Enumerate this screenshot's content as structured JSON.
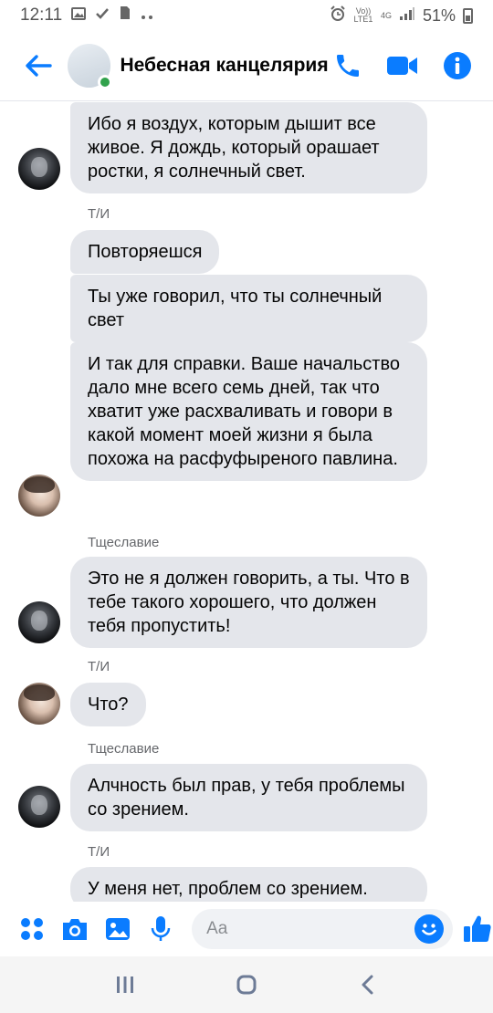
{
  "status_bar": {
    "time": "12:11",
    "left_icons": [
      "image-icon",
      "check-icon",
      "sim-icon",
      "more-icon"
    ],
    "volte": "Vo)) LTE1",
    "network": "4G",
    "battery": "51%"
  },
  "header": {
    "title": "Небесная канцелярия",
    "online": true
  },
  "chat": {
    "messages": [
      {
        "sender": "",
        "avatar": "dark",
        "text": "Ибо я воздух, которым дышит все живое. Я дождь, который орашает ростки, я солнечный свет."
      },
      {
        "sender": "Т/И",
        "avatar": "girl",
        "text": "Повторяешся"
      },
      {
        "sender": "",
        "avatar": "girl",
        "text": "Ты уже говорил, что ты солнечный свет"
      },
      {
        "sender": "",
        "avatar": "girl",
        "text": "И так для справки. Ваше начальство дало мне всего семь дней, так что хватит уже расхваливать и говори в какой момент моей жизни я  была похожа на расфуфыреного павлина."
      },
      {
        "sender": "Тщеславие",
        "avatar": "dark",
        "text": "Это не я должен говорить, а ты. Что в тебе такого хорошего, что должен тебя пропустить!"
      },
      {
        "sender": "Т/И",
        "avatar": "girl",
        "text": "Что?"
      },
      {
        "sender": "Тщеславие",
        "avatar": "dark",
        "text": "Алчность был прав, у тебя проблемы со зрением."
      },
      {
        "sender": "Т/И",
        "avatar": "girl",
        "text": "У меня нет, проблем со зрением."
      }
    ]
  },
  "composer": {
    "placeholder": "Aa",
    "value": ""
  },
  "colors": {
    "accent": "#0a7cff",
    "bubble": "#e4e6eb",
    "online": "#31a24c"
  }
}
